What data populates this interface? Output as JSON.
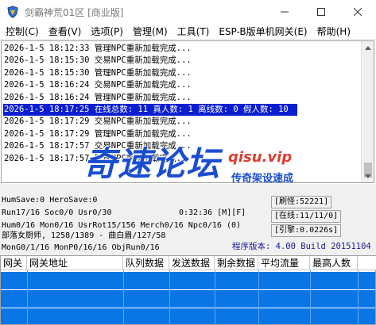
{
  "window": {
    "title": "剑霸神荒01区 [商业版]",
    "accent": "#0a1fd0",
    "row_fill": "#0a76e6",
    "icons": {
      "app": "game-shield-icon",
      "minimize": "minimize-icon",
      "maximize": "maximize-icon",
      "close": "close-icon"
    }
  },
  "menu": [
    {
      "label": "控制(C)"
    },
    {
      "label": "查看(V)"
    },
    {
      "label": "选项(P)"
    },
    {
      "label": "管理(M)"
    },
    {
      "label": "工具(T)"
    },
    {
      "label": "ESP-B版单机网关(E)"
    },
    {
      "label": "帮助(H)"
    }
  ],
  "log": [
    {
      "text": "2026-1-5 18:12:33 管理NPC重新加载完成..."
    },
    {
      "text": "2026-1-5 18:15:30 交易NPC重新加载完成..."
    },
    {
      "text": "2026-1-5 18:15:30 管理NPC重新加载完成..."
    },
    {
      "text": "2026-1-5 18:16:24 交易NPC重新加载完成..."
    },
    {
      "text": "2026-1-5 18:16:24 管理NPC重新加载完成..."
    },
    {
      "text": "2026-1-5 18:17:25 在线总数: 11 真人数: 1 离线数: 0 假人数: 10",
      "selected": true
    },
    {
      "text": "2026-1-5 18:17:29 交易NPC重新加载完成..."
    },
    {
      "text": "2026-1-5 18:17:29 管理NPC重新加载完成..."
    },
    {
      "text": "2026-1-5 18:17:57 交易NPC重新加载完成..."
    },
    {
      "text": "2026-1-5 18:17:57 管理NPC重新加载完成..."
    }
  ],
  "watermark": {
    "big": "奇速论坛",
    "url": "qisu.vip",
    "tag": "传奇架设速成"
  },
  "status": {
    "humsave": "HumSave:0 HeroSave:0",
    "run": "Run17/16 Soc0/0 Usr0/30",
    "time": "0:32:36 [M][F]",
    "hum": "Hum0/16 Mon0/16 UsrRot15/156 Merch0/16 Npc0/16 (0)",
    "map": "部落女厨师, 1258/1389 - 曲白眉/127/58",
    "mongo": "MonG0/1/16 MonP0/16/16 ObjRun0/16",
    "brush": "[刷怪:52221]",
    "online": "[在线:11/11/0]",
    "engine": "[引擎:0.0226s]",
    "version": "程序版本: 4.00 Build 20151104"
  },
  "table": {
    "columns": [
      {
        "label": "网关"
      },
      {
        "label": "网关地址"
      },
      {
        "label": "队列数据"
      },
      {
        "label": "发送数据"
      },
      {
        "label": "剩余数据"
      },
      {
        "label": "平均流量"
      },
      {
        "label": "最高人数"
      }
    ]
  }
}
